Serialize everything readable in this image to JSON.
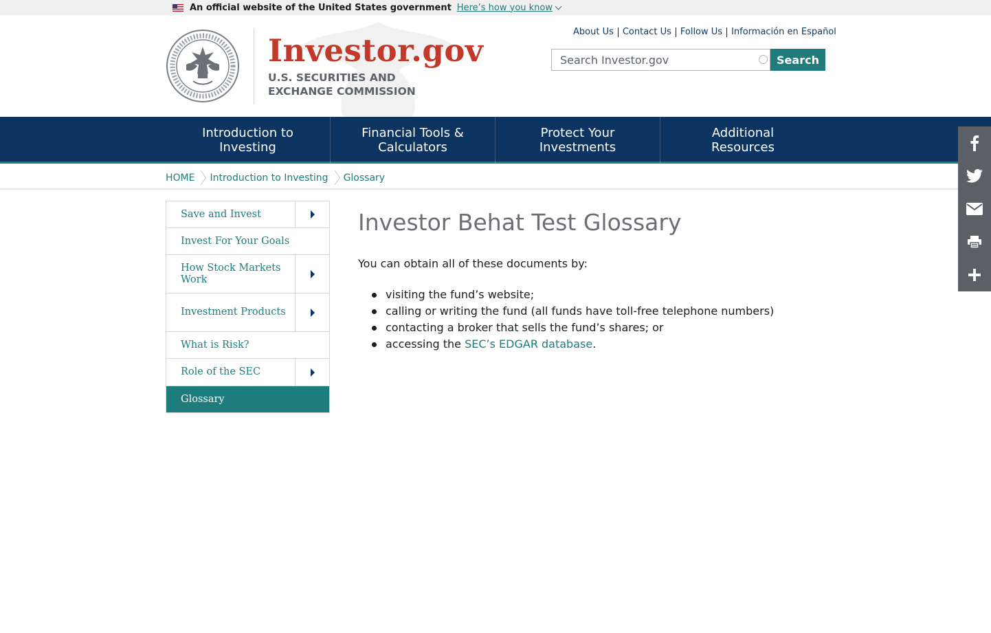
{
  "gov_banner": {
    "text": "An official website of the United States government",
    "link_label": "Here’s how you know"
  },
  "header": {
    "site_name": "Investor.gov",
    "agency_line1": "U.S. SECURITIES AND",
    "agency_line2": "EXCHANGE COMMISSION",
    "utility_links": [
      "About Us",
      "Contact Us",
      "Follow Us",
      "Información en Español"
    ],
    "search": {
      "placeholder": "Search Investor.gov",
      "button_label": "Search"
    }
  },
  "main_nav": [
    {
      "line1": "Introduction to",
      "line2": "Investing"
    },
    {
      "line1": "Financial Tools &",
      "line2": "Calculators"
    },
    {
      "line1": "Protect Your",
      "line2": "Investments"
    },
    {
      "line1": "Additional",
      "line2": "Resources"
    }
  ],
  "breadcrumb": [
    "HOME",
    "Introduction to Investing",
    "Glossary"
  ],
  "sidebar": [
    {
      "label": "Save and Invest",
      "expandable": true
    },
    {
      "label": "Invest For Your Goals",
      "expandable": false
    },
    {
      "label": "How Stock Markets Work",
      "expandable": true
    },
    {
      "label": "Investment Products",
      "expandable": true
    },
    {
      "label": "What is Risk?",
      "expandable": false
    },
    {
      "label": "Role of the SEC",
      "expandable": true
    },
    {
      "label": "Glossary",
      "expandable": false,
      "active": true
    }
  ],
  "content": {
    "title": "Investor Behat Test Glossary",
    "intro": "You can obtain all of these documents by:",
    "bullets": [
      "visiting the fund’s website;",
      "calling or writing the fund (all funds have toll-free telephone numbers)",
      "contacting a broker that sells the fund’s shares; or"
    ],
    "last_bullet_prefix": "accessing the",
    "last_bullet_link": "SEC’s EDGAR database",
    "last_bullet_suffix": "."
  },
  "share_rail": [
    "facebook-icon",
    "twitter-icon",
    "email-icon",
    "print-icon",
    "plus-icon"
  ],
  "colors": {
    "brand_red": "#c0392b",
    "nav_navy": "#0d3460",
    "teal": "#1f7c7c",
    "share_gray": "#5b6066"
  }
}
